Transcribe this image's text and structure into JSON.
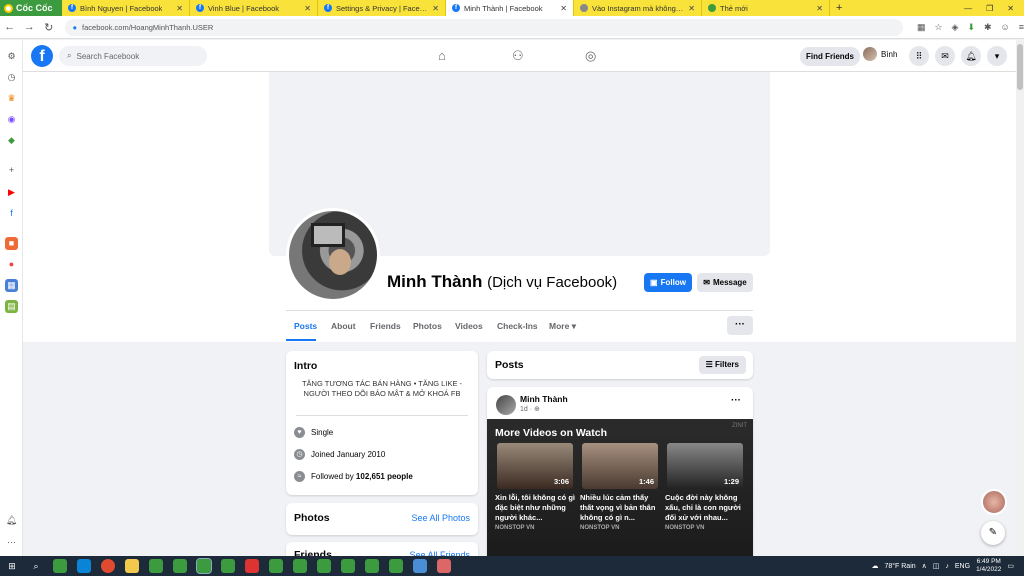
{
  "browser": {
    "brand": "Cốc Cốc",
    "tabs": [
      {
        "title": "Bình Nguyen | Facebook",
        "icon": "facebook-icon"
      },
      {
        "title": "Vinh Blue | Facebook",
        "icon": "facebook-icon"
      },
      {
        "title": "Settings & Privacy | Facebook",
        "icon": "facebook-icon"
      },
      {
        "title": "Minh Thành | Facebook",
        "icon": "facebook-icon",
        "active": true
      },
      {
        "title": "Vào Instagram mà không cần...",
        "icon": "globe-icon"
      },
      {
        "title": "Thẻ mới",
        "icon": "new-tab-icon"
      }
    ],
    "url": "facebook.com/HoangMinhThanh.USER"
  },
  "fb_header": {
    "search_placeholder": "Search Facebook",
    "find_friends": "Find Friends",
    "user_name": "Bình"
  },
  "profile": {
    "name": "Minh Thành",
    "category": "(Dịch vụ Facebook)",
    "follow_label": "Follow",
    "message_label": "Message",
    "tabs": [
      "Posts",
      "About",
      "Friends",
      "Photos",
      "Videos",
      "Check-Ins",
      "More"
    ],
    "more_dots": "···"
  },
  "intro": {
    "title": "Intro",
    "bio": "TĂNG TƯƠNG TÁC BÁN HÀNG • TĂNG LIKE - NGƯỜI THEO DÕI BẢO MẬT & MỞ KHOÁ FB",
    "relationship": "Single",
    "joined": "Joined January 2010",
    "followed_prefix": "Followed by ",
    "followed_count": "102,651 people"
  },
  "photos": {
    "title": "Photos",
    "see_all": "See All Photos"
  },
  "friends": {
    "title": "Friends",
    "see_all": "See All Friends"
  },
  "posts": {
    "title": "Posts",
    "filters": "Filters",
    "post": {
      "author": "Minh Thành",
      "time": "1d · ",
      "watch_title": "More Videos on Watch",
      "videos": [
        {
          "duration": "3:06",
          "title": "Xin lỗi, tôi không có gì đặc biệt như những người khác...",
          "source": "NONSTOP VN"
        },
        {
          "duration": "1:46",
          "title": "Nhiều lúc cảm thấy thất vọng vì bản thân không có gì n...",
          "source": "NONSTOP VN"
        },
        {
          "duration": "1:29",
          "title": "Cuộc đời này không xấu, chỉ là con người đối xử với nhau...",
          "source": "NONSTOP VN"
        }
      ]
    }
  },
  "taskbar": {
    "weather": "78°F  Rain",
    "lang": "ENG",
    "time": "6:49 PM",
    "date": "1/4/2022"
  },
  "colors": {
    "fb_blue": "#1877f2",
    "tabbar": "#f9e23a",
    "coccoc_green": "#3c9a3f"
  }
}
